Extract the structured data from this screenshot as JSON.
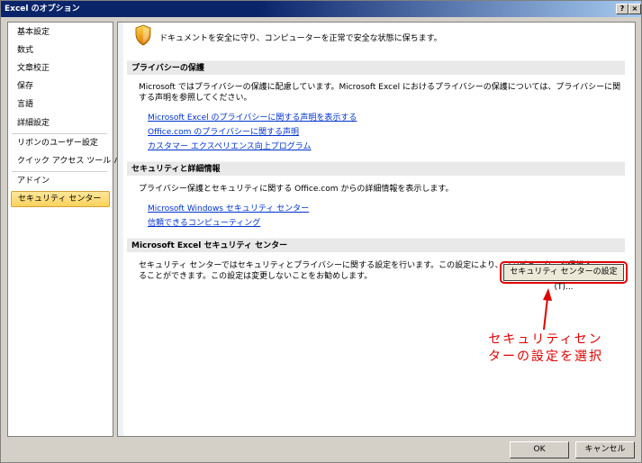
{
  "window": {
    "title": "Excel のオプション",
    "help_label": "?",
    "close_label": "×"
  },
  "sidebar": {
    "items": [
      {
        "label": "基本設定"
      },
      {
        "label": "数式"
      },
      {
        "label": "文章校正"
      },
      {
        "label": "保存"
      },
      {
        "label": "言語"
      },
      {
        "label": "詳細設定"
      },
      {
        "label": "リボンのユーザー設定"
      },
      {
        "label": "クイック アクセス ツール バー"
      },
      {
        "label": "アドイン"
      },
      {
        "label": "セキュリティ センター"
      }
    ],
    "selected_index": 9
  },
  "main": {
    "intro": "ドキュメントを安全に守り、コンピューターを正常で安全な状態に保ちます。",
    "sections": [
      {
        "header": "プライバシーの保護",
        "text": "Microsoft ではプライバシーの保護に配慮しています。Microsoft Excel におけるプライバシーの保護については、プライバシーに関する声明を参照してください。",
        "links": [
          "Microsoft Excel のプライバシーに関する声明を表示する",
          "Office.com のプライバシーに関する声明",
          "カスタマー エクスペリエンス向上プログラム"
        ]
      },
      {
        "header": "セキュリティと詳細情報",
        "text": "プライバシー保護とセキュリティに関する Office.com からの詳細情報を表示します。",
        "links": [
          "Microsoft Windows セキュリティ センター",
          "信頼できるコンピューティング"
        ]
      },
      {
        "header": "Microsoft Excel セキュリティ センター",
        "text_line1": "セキュリティ センターではセキュリティとプライバシーに関する設定を行います。この設定により、コンピューターを保護す",
        "text_line2": "ることができます。この設定は変更しないことをお勧めします。",
        "button": "セキュリティ センターの設定(T)..."
      }
    ]
  },
  "annotation": {
    "line1": "セキュリティセン",
    "line2": "ターの設定を選択",
    "color": "#e00000"
  },
  "footer": {
    "ok_label": "OK",
    "cancel_label": "キャンセル"
  }
}
